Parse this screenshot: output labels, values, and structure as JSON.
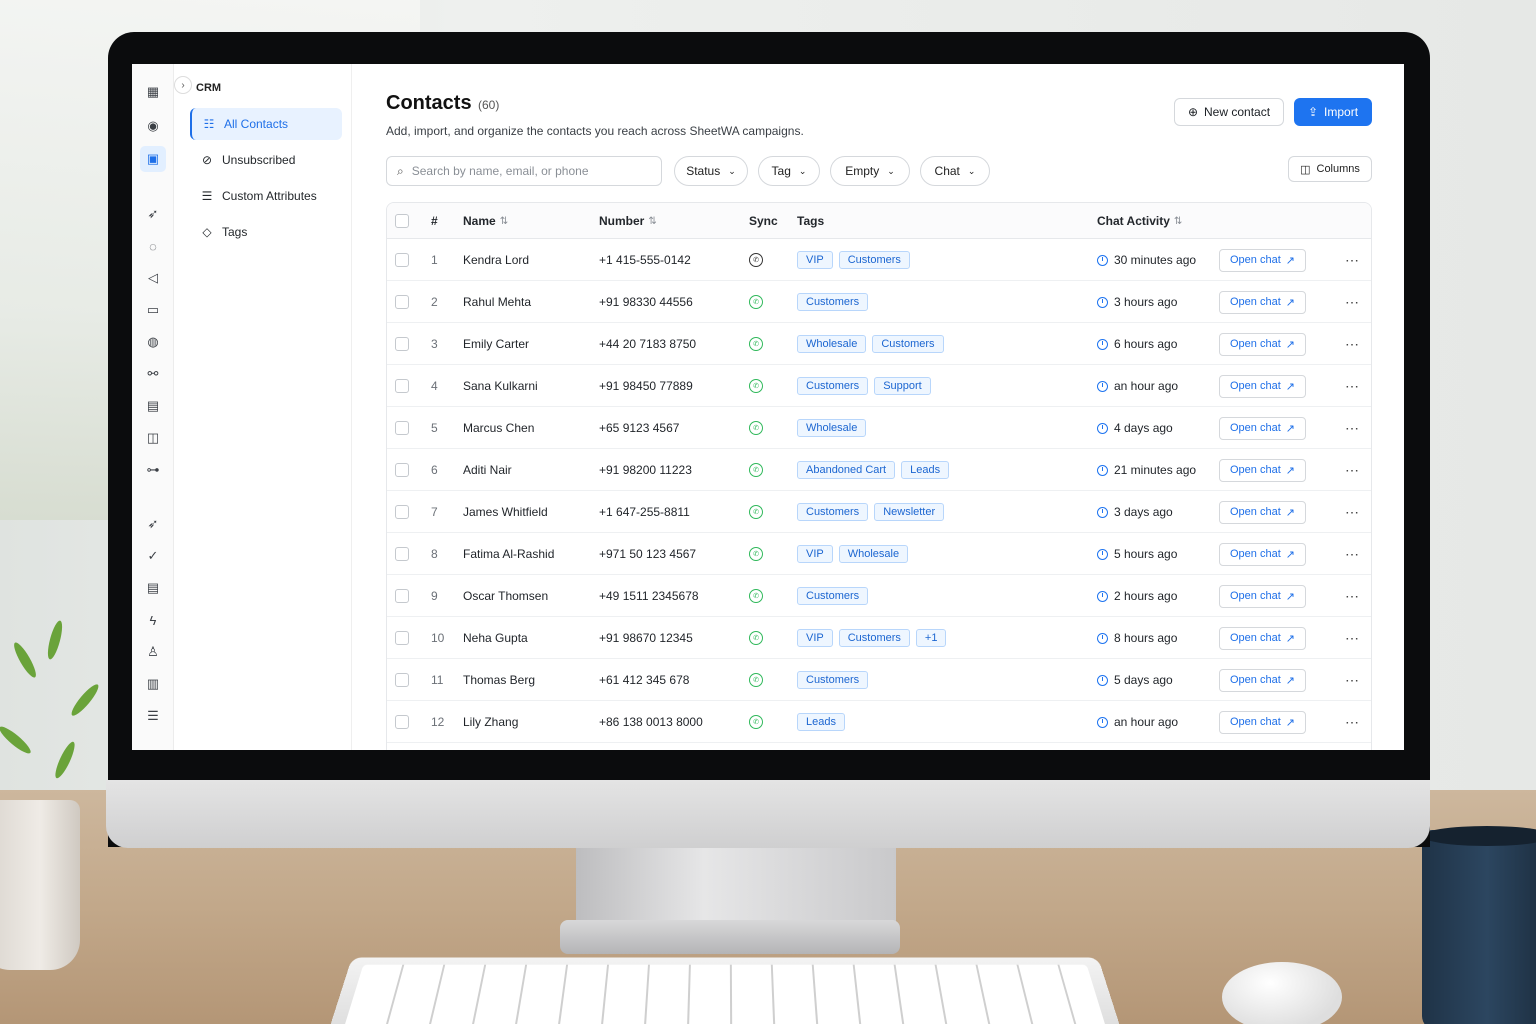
{
  "sidebar": {
    "section": "CRM",
    "items": [
      {
        "label": "All Contacts",
        "icon": "list-icon",
        "active": true
      },
      {
        "label": "Unsubscribed",
        "icon": "block-icon",
        "active": false
      },
      {
        "label": "Custom Attributes",
        "icon": "sliders-icon",
        "active": false
      },
      {
        "label": "Tags",
        "icon": "tag-icon",
        "active": false
      }
    ]
  },
  "header": {
    "title": "Contacts",
    "count": "(60)",
    "subtitle": "Add, import, and organize the contacts you reach across SheetWA campaigns.",
    "new_contact_label": "New contact",
    "import_label": "Import"
  },
  "toolbar": {
    "search_placeholder": "Search by name, email, or phone",
    "filters": [
      "Status",
      "Tag",
      "Empty",
      "Chat"
    ],
    "columns_label": "Columns"
  },
  "table": {
    "headers": {
      "index": "#",
      "name": "Name",
      "number": "Number",
      "sync": "Sync",
      "tags": "Tags",
      "activity": "Chat Activity"
    },
    "open_chat_label": "Open chat",
    "rows": [
      {
        "idx": "1",
        "name": "Kendra Lord",
        "number": "+1 415-555-0142",
        "tags": [
          "VIP",
          "Customers"
        ],
        "activity": "30 minutes ago"
      },
      {
        "idx": "2",
        "name": "Rahul Mehta",
        "number": "+91 98330 44556",
        "tags": [
          "Customers"
        ],
        "activity": "3 hours ago"
      },
      {
        "idx": "3",
        "name": "Emily Carter",
        "number": "+44 20 7183 8750",
        "tags": [
          "Wholesale",
          "Customers"
        ],
        "activity": "6 hours ago"
      },
      {
        "idx": "4",
        "name": "Sana Kulkarni",
        "number": "+91 98450 77889",
        "tags": [
          "Customers",
          "Support"
        ],
        "activity": "an hour ago"
      },
      {
        "idx": "5",
        "name": "Marcus Chen",
        "number": "+65 9123 4567",
        "tags": [
          "Wholesale"
        ],
        "activity": "4 days ago"
      },
      {
        "idx": "6",
        "name": "Aditi Nair",
        "number": "+91 98200 11223",
        "tags": [
          "Abandoned Cart",
          "Leads"
        ],
        "activity": "21 minutes ago"
      },
      {
        "idx": "7",
        "name": "James Whitfield",
        "number": "+1 647-255-8811",
        "tags": [
          "Customers",
          "Newsletter"
        ],
        "activity": "3 days ago"
      },
      {
        "idx": "8",
        "name": "Fatima Al-Rashid",
        "number": "+971 50 123 4567",
        "tags": [
          "VIP",
          "Wholesale"
        ],
        "activity": "5 hours ago"
      },
      {
        "idx": "9",
        "name": "Oscar Thomsen",
        "number": "+49 1511 2345678",
        "tags": [
          "Customers"
        ],
        "activity": "2 hours ago"
      },
      {
        "idx": "10",
        "name": "Neha Gupta",
        "number": "+91 98670 12345",
        "tags": [
          "VIP",
          "Customers",
          "+1"
        ],
        "activity": "8 hours ago"
      },
      {
        "idx": "11",
        "name": "Thomas Berg",
        "number": "+61 412 345 678",
        "tags": [
          "Customers"
        ],
        "activity": "5 days ago"
      },
      {
        "idx": "12",
        "name": "Lily Zhang",
        "number": "+86 138 0013 8000",
        "tags": [
          "Leads"
        ],
        "activity": "an hour ago"
      }
    ]
  },
  "colors": {
    "accent": "#1e74f0",
    "tag_bg": "#eef6ff",
    "whatsapp": "#2fb85a"
  }
}
